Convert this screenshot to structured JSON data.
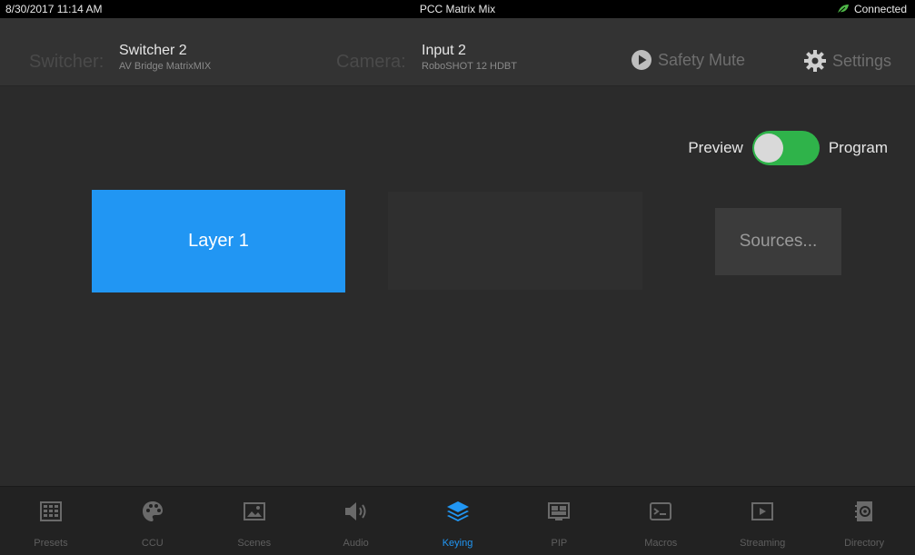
{
  "status": {
    "datetime": "8/30/2017 11:14 AM",
    "title": "PCC Matrix Mix",
    "connection": "Connected",
    "connection_color": "#4fb848"
  },
  "header": {
    "switcher_label": "Switcher:",
    "switcher_name": "Switcher 2",
    "switcher_model": "AV Bridge MatrixMIX",
    "camera_label": "Camera:",
    "camera_input": "Input 2",
    "camera_model": "RoboSHOT 12 HDBT",
    "safety_mute": "Safety Mute",
    "settings": "Settings"
  },
  "main": {
    "toggle_left": "Preview",
    "toggle_right": "Program",
    "toggle_on": true,
    "layer_button": "Layer 1",
    "sources_button": "Sources..."
  },
  "tabs": [
    {
      "label": "Presets",
      "icon": "presets-grid-icon"
    },
    {
      "label": "CCU",
      "icon": "palette-icon"
    },
    {
      "label": "Scenes",
      "icon": "picture-icon"
    },
    {
      "label": "Audio",
      "icon": "speaker-icon"
    },
    {
      "label": "Keying",
      "icon": "layers-icon",
      "active": true
    },
    {
      "label": "PIP",
      "icon": "pip-icon"
    },
    {
      "label": "Macros",
      "icon": "terminal-icon"
    },
    {
      "label": "Streaming",
      "icon": "play-box-icon"
    },
    {
      "label": "Directory",
      "icon": "address-book-icon"
    }
  ],
  "colors": {
    "accent": "#2196f3",
    "toggle_green": "#2fb34a",
    "background": "#2b2b2b"
  }
}
